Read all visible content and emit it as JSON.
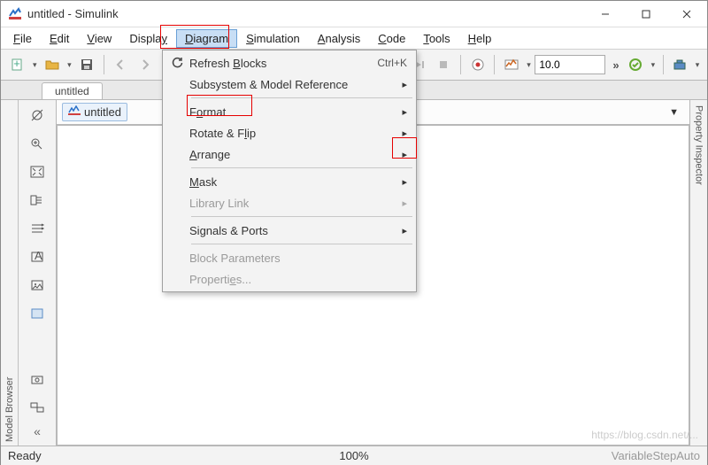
{
  "window": {
    "title": "untitled - Simulink",
    "minimize": "—",
    "maximize": "☐",
    "close": "✕"
  },
  "menubar": {
    "items": [
      "File",
      "Edit",
      "View",
      "Display",
      "Diagram",
      "Simulation",
      "Analysis",
      "Code",
      "Tools",
      "Help"
    ],
    "active_index": 4
  },
  "toolbar": {
    "step_value": "10.0",
    "icons": {
      "new": "new-model-icon",
      "open": "open-folder-icon",
      "save": "save-icon",
      "back": "arrow-left-icon",
      "fwd": "arrow-right-icon",
      "up": "arrow-up-icon",
      "config": "gear-icon",
      "run": "play-icon",
      "step": "step-fwd-icon",
      "stop": "stop-icon",
      "record": "record-icon",
      "chart": "scope-chart-icon",
      "more": "»",
      "ok": "check-circle-icon",
      "toolbox": "build-icon"
    }
  },
  "tabs": {
    "items": [
      "untitled"
    ]
  },
  "breadcrumb": {
    "model": "untitled"
  },
  "left_panel": {
    "title": "Model Browser",
    "buttons": [
      "hide",
      "zoom-in",
      "fit",
      "explorer",
      "sequence",
      "annotate",
      "image",
      "viewmark",
      "screenshot",
      "legend"
    ],
    "collapse": "«"
  },
  "right_panel": {
    "title": "Property Inspector"
  },
  "dropdown": {
    "items": [
      {
        "icon": "refresh-icon",
        "label_pre": "Refresh ",
        "label_ul": "B",
        "label_post": "locks",
        "shortcut": "Ctrl+K",
        "arrow": false,
        "enabled": true
      },
      {
        "icon": "",
        "label_pre": "Subsystem & Model Reference",
        "label_ul": "",
        "label_post": "",
        "shortcut": "",
        "arrow": true,
        "enabled": true
      },
      {
        "sep": true
      },
      {
        "icon": "",
        "label_pre": "F",
        "label_ul": "o",
        "label_post": "rmat",
        "shortcut": "",
        "arrow": true,
        "enabled": true,
        "box": "lbl"
      },
      {
        "icon": "",
        "label_pre": "Rotate & F",
        "label_ul": "l",
        "label_post": "ip",
        "shortcut": "",
        "arrow": true,
        "enabled": true
      },
      {
        "icon": "",
        "label_pre": "",
        "label_ul": "A",
        "label_post": "rrange",
        "shortcut": "",
        "arrow": true,
        "enabled": true,
        "box": "arrow"
      },
      {
        "sep": true
      },
      {
        "icon": "",
        "label_pre": "",
        "label_ul": "M",
        "label_post": "ask",
        "shortcut": "",
        "arrow": true,
        "enabled": true
      },
      {
        "icon": "",
        "label_pre": "Library Link",
        "label_ul": "",
        "label_post": "",
        "shortcut": "",
        "arrow": true,
        "enabled": false
      },
      {
        "sep": true
      },
      {
        "icon": "",
        "label_pre": "Si",
        "label_ul": "g",
        "label_post": "nals & Ports",
        "shortcut": "",
        "arrow": true,
        "enabled": true
      },
      {
        "sep": true
      },
      {
        "icon": "",
        "label_pre": "Block Parameters",
        "label_ul": "",
        "label_post": "",
        "shortcut": "",
        "arrow": false,
        "enabled": false
      },
      {
        "icon": "",
        "label_pre": "Properti",
        "label_ul": "e",
        "label_post": "s...",
        "shortcut": "",
        "arrow": false,
        "enabled": false
      }
    ]
  },
  "status": {
    "left": "Ready",
    "center": "100%",
    "right": "VariableStepAuto"
  },
  "watermark": "https://blog.csdn.net/..."
}
